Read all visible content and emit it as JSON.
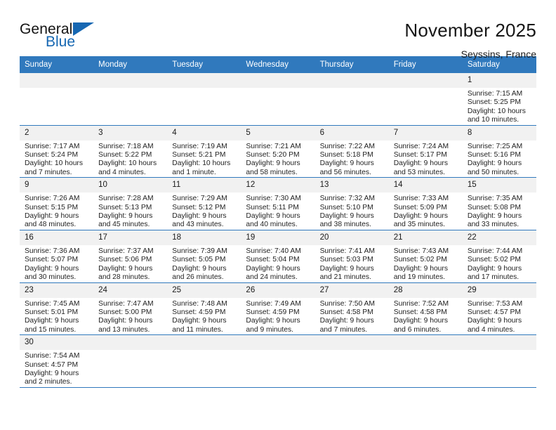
{
  "brand": {
    "name_top": "General",
    "name_bottom": "Blue",
    "triangle_color": "#1667b2"
  },
  "header": {
    "title": "November 2025",
    "subtitle": "Seyssins, France",
    "accent_color": "#3079bd",
    "daynum_bg": "#f1f1f1"
  },
  "weekdays": [
    "Sunday",
    "Monday",
    "Tuesday",
    "Wednesday",
    "Thursday",
    "Friday",
    "Saturday"
  ],
  "weeks": [
    [
      {
        "empty": true
      },
      {
        "empty": true
      },
      {
        "empty": true
      },
      {
        "empty": true
      },
      {
        "empty": true
      },
      {
        "empty": true
      },
      {
        "day": "1",
        "sunrise": "Sunrise: 7:15 AM",
        "sunset": "Sunset: 5:25 PM",
        "daylight1": "Daylight: 10 hours",
        "daylight2": "and 10 minutes."
      }
    ],
    [
      {
        "day": "2",
        "sunrise": "Sunrise: 7:17 AM",
        "sunset": "Sunset: 5:24 PM",
        "daylight1": "Daylight: 10 hours",
        "daylight2": "and 7 minutes."
      },
      {
        "day": "3",
        "sunrise": "Sunrise: 7:18 AM",
        "sunset": "Sunset: 5:22 PM",
        "daylight1": "Daylight: 10 hours",
        "daylight2": "and 4 minutes."
      },
      {
        "day": "4",
        "sunrise": "Sunrise: 7:19 AM",
        "sunset": "Sunset: 5:21 PM",
        "daylight1": "Daylight: 10 hours",
        "daylight2": "and 1 minute."
      },
      {
        "day": "5",
        "sunrise": "Sunrise: 7:21 AM",
        "sunset": "Sunset: 5:20 PM",
        "daylight1": "Daylight: 9 hours",
        "daylight2": "and 58 minutes."
      },
      {
        "day": "6",
        "sunrise": "Sunrise: 7:22 AM",
        "sunset": "Sunset: 5:18 PM",
        "daylight1": "Daylight: 9 hours",
        "daylight2": "and 56 minutes."
      },
      {
        "day": "7",
        "sunrise": "Sunrise: 7:24 AM",
        "sunset": "Sunset: 5:17 PM",
        "daylight1": "Daylight: 9 hours",
        "daylight2": "and 53 minutes."
      },
      {
        "day": "8",
        "sunrise": "Sunrise: 7:25 AM",
        "sunset": "Sunset: 5:16 PM",
        "daylight1": "Daylight: 9 hours",
        "daylight2": "and 50 minutes."
      }
    ],
    [
      {
        "day": "9",
        "sunrise": "Sunrise: 7:26 AM",
        "sunset": "Sunset: 5:15 PM",
        "daylight1": "Daylight: 9 hours",
        "daylight2": "and 48 minutes."
      },
      {
        "day": "10",
        "sunrise": "Sunrise: 7:28 AM",
        "sunset": "Sunset: 5:13 PM",
        "daylight1": "Daylight: 9 hours",
        "daylight2": "and 45 minutes."
      },
      {
        "day": "11",
        "sunrise": "Sunrise: 7:29 AM",
        "sunset": "Sunset: 5:12 PM",
        "daylight1": "Daylight: 9 hours",
        "daylight2": "and 43 minutes."
      },
      {
        "day": "12",
        "sunrise": "Sunrise: 7:30 AM",
        "sunset": "Sunset: 5:11 PM",
        "daylight1": "Daylight: 9 hours",
        "daylight2": "and 40 minutes."
      },
      {
        "day": "13",
        "sunrise": "Sunrise: 7:32 AM",
        "sunset": "Sunset: 5:10 PM",
        "daylight1": "Daylight: 9 hours",
        "daylight2": "and 38 minutes."
      },
      {
        "day": "14",
        "sunrise": "Sunrise: 7:33 AM",
        "sunset": "Sunset: 5:09 PM",
        "daylight1": "Daylight: 9 hours",
        "daylight2": "and 35 minutes."
      },
      {
        "day": "15",
        "sunrise": "Sunrise: 7:35 AM",
        "sunset": "Sunset: 5:08 PM",
        "daylight1": "Daylight: 9 hours",
        "daylight2": "and 33 minutes."
      }
    ],
    [
      {
        "day": "16",
        "sunrise": "Sunrise: 7:36 AM",
        "sunset": "Sunset: 5:07 PM",
        "daylight1": "Daylight: 9 hours",
        "daylight2": "and 30 minutes."
      },
      {
        "day": "17",
        "sunrise": "Sunrise: 7:37 AM",
        "sunset": "Sunset: 5:06 PM",
        "daylight1": "Daylight: 9 hours",
        "daylight2": "and 28 minutes."
      },
      {
        "day": "18",
        "sunrise": "Sunrise: 7:39 AM",
        "sunset": "Sunset: 5:05 PM",
        "daylight1": "Daylight: 9 hours",
        "daylight2": "and 26 minutes."
      },
      {
        "day": "19",
        "sunrise": "Sunrise: 7:40 AM",
        "sunset": "Sunset: 5:04 PM",
        "daylight1": "Daylight: 9 hours",
        "daylight2": "and 24 minutes."
      },
      {
        "day": "20",
        "sunrise": "Sunrise: 7:41 AM",
        "sunset": "Sunset: 5:03 PM",
        "daylight1": "Daylight: 9 hours",
        "daylight2": "and 21 minutes."
      },
      {
        "day": "21",
        "sunrise": "Sunrise: 7:43 AM",
        "sunset": "Sunset: 5:02 PM",
        "daylight1": "Daylight: 9 hours",
        "daylight2": "and 19 minutes."
      },
      {
        "day": "22",
        "sunrise": "Sunrise: 7:44 AM",
        "sunset": "Sunset: 5:02 PM",
        "daylight1": "Daylight: 9 hours",
        "daylight2": "and 17 minutes."
      }
    ],
    [
      {
        "day": "23",
        "sunrise": "Sunrise: 7:45 AM",
        "sunset": "Sunset: 5:01 PM",
        "daylight1": "Daylight: 9 hours",
        "daylight2": "and 15 minutes."
      },
      {
        "day": "24",
        "sunrise": "Sunrise: 7:47 AM",
        "sunset": "Sunset: 5:00 PM",
        "daylight1": "Daylight: 9 hours",
        "daylight2": "and 13 minutes."
      },
      {
        "day": "25",
        "sunrise": "Sunrise: 7:48 AM",
        "sunset": "Sunset: 4:59 PM",
        "daylight1": "Daylight: 9 hours",
        "daylight2": "and 11 minutes."
      },
      {
        "day": "26",
        "sunrise": "Sunrise: 7:49 AM",
        "sunset": "Sunset: 4:59 PM",
        "daylight1": "Daylight: 9 hours",
        "daylight2": "and 9 minutes."
      },
      {
        "day": "27",
        "sunrise": "Sunrise: 7:50 AM",
        "sunset": "Sunset: 4:58 PM",
        "daylight1": "Daylight: 9 hours",
        "daylight2": "and 7 minutes."
      },
      {
        "day": "28",
        "sunrise": "Sunrise: 7:52 AM",
        "sunset": "Sunset: 4:58 PM",
        "daylight1": "Daylight: 9 hours",
        "daylight2": "and 6 minutes."
      },
      {
        "day": "29",
        "sunrise": "Sunrise: 7:53 AM",
        "sunset": "Sunset: 4:57 PM",
        "daylight1": "Daylight: 9 hours",
        "daylight2": "and 4 minutes."
      }
    ],
    [
      {
        "day": "30",
        "sunrise": "Sunrise: 7:54 AM",
        "sunset": "Sunset: 4:57 PM",
        "daylight1": "Daylight: 9 hours",
        "daylight2": "and 2 minutes."
      },
      {
        "empty": true
      },
      {
        "empty": true
      },
      {
        "empty": true
      },
      {
        "empty": true
      },
      {
        "empty": true
      },
      {
        "empty": true
      }
    ]
  ]
}
